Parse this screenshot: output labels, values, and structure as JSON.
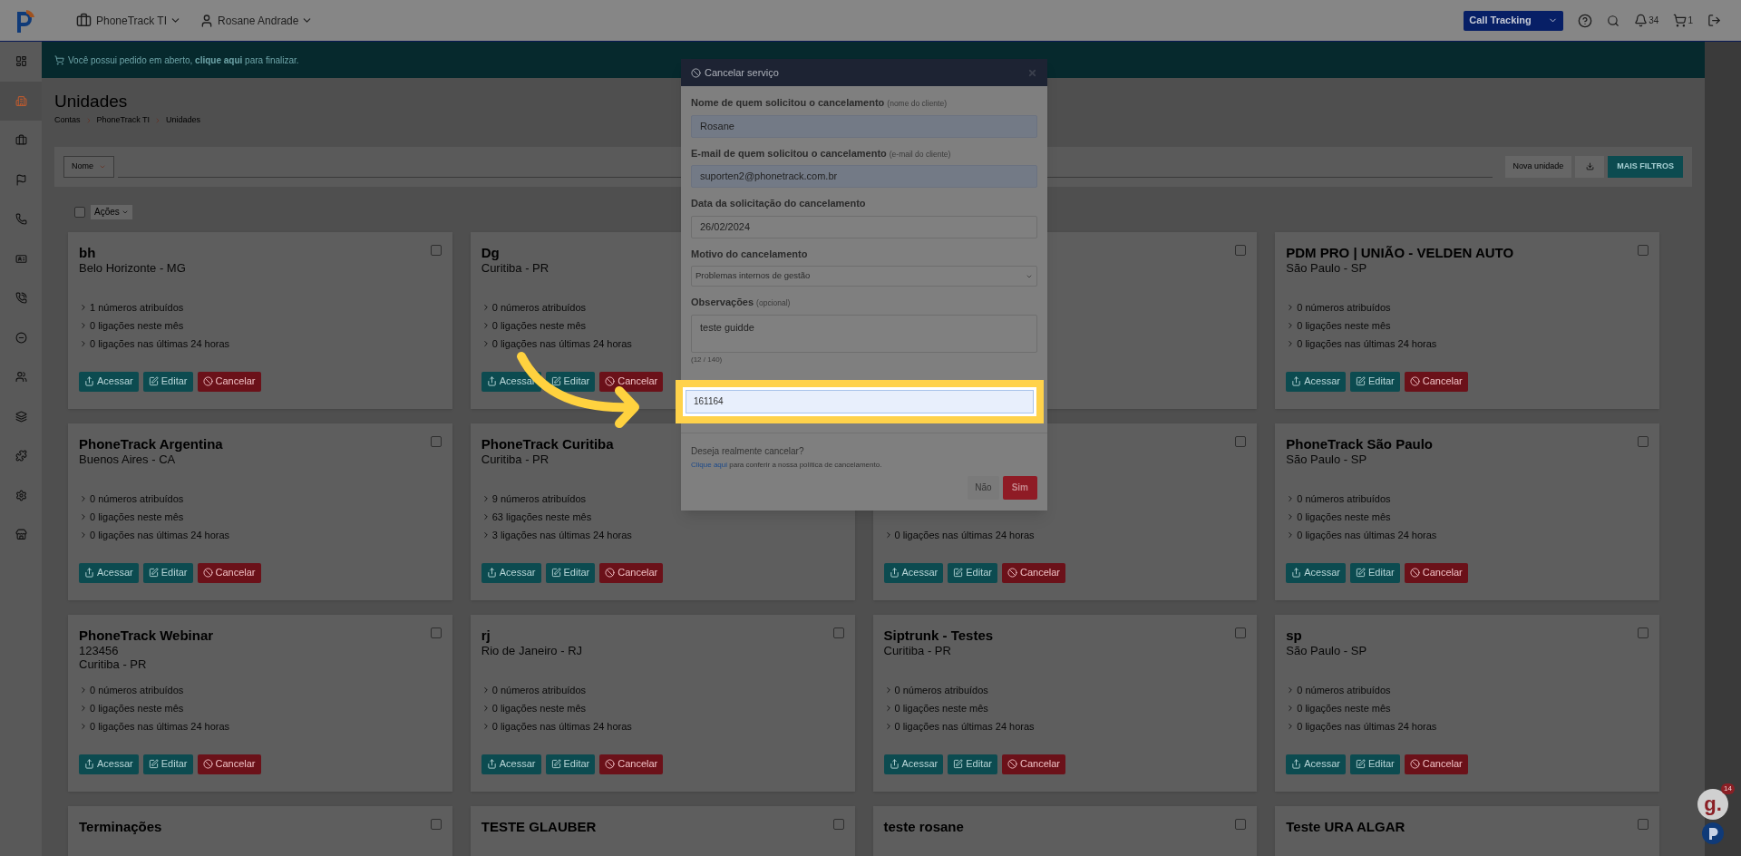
{
  "topbar": {
    "account": "PhoneTrack TI",
    "user": "Rosane Andrade",
    "product": "Call Tracking",
    "notifications": "34",
    "cart": "1"
  },
  "sidebar": {
    "items": [
      {
        "selected": false
      },
      {
        "selected": true
      },
      {
        "selected": false
      },
      {
        "selected": false
      },
      {
        "selected": false
      },
      {
        "selected": false
      },
      {
        "selected": false
      },
      {
        "selected": false
      },
      {
        "selected": false
      },
      {
        "selected": false
      },
      {
        "selected": false
      },
      {
        "selected": false
      },
      {
        "selected": false
      }
    ]
  },
  "banner": "Você possui pedido em aberto, **clique aqui** para finalizar.",
  "page": {
    "title": "Unidades",
    "breadcrumb": [
      "Contas",
      "PhoneTrack TI",
      "Unidades"
    ]
  },
  "filters": {
    "field": "Nome",
    "buttons": [
      "Nova unidade",
      "MAIS FILTROS"
    ]
  },
  "actions": {
    "label": "Ações",
    "checked": false
  },
  "cards": [
    {
      "title": "bh",
      "subtitles": [
        "Belo Horizonte - MG"
      ],
      "lines": [
        "1 números atribuídos",
        "0 ligações neste mês",
        "0 ligações nas últimas 24 horas"
      ],
      "checked": false,
      "buttons": [
        {
          "kind": "access",
          "label": "Acessar"
        },
        {
          "kind": "edit",
          "label": "Editar"
        },
        {
          "kind": "cancel",
          "label": "Cancelar"
        }
      ]
    },
    {
      "title": "Dg",
      "subtitles": [
        "Curitiba - PR"
      ],
      "lines": [
        "0 números atribuídos",
        "0 ligações neste mês",
        "0 ligações nas últimas 24 horas"
      ],
      "buttons": [
        {
          "kind": "access",
          "label": "Acessar"
        },
        {
          "kind": "edit",
          "label": "Editar"
        },
        {
          "kind": "cancel",
          "label": "Cancelar"
        }
      ]
    },
    {
      "checked": false
    },
    {
      "title": "PDM PRO | UNIÃO - VELDEN AUTO",
      "subtitles": [
        "São Paulo - SP"
      ],
      "lines": [
        "0 números atribuídos",
        "0 ligações neste mês",
        "0 ligações nas últimas 24 horas"
      ],
      "checked": false,
      "buttons": [
        {
          "kind": "access",
          "label": "Acessar"
        },
        {
          "kind": "edit",
          "label": "Editar"
        },
        {
          "kind": "cancel",
          "label": "Cancelar"
        }
      ]
    },
    {
      "title": "PhoneTrack Argentina",
      "subtitles": [
        "Buenos Aires - CA"
      ],
      "lines": [
        "0 números atribuídos",
        "0 ligações neste mês",
        "0 ligações nas últimas 24 horas"
      ],
      "checked": false,
      "buttons": [
        {
          "kind": "access",
          "label": "Acessar"
        },
        {
          "kind": "edit",
          "label": "Editar"
        },
        {
          "kind": "cancel",
          "label": "Cancelar"
        }
      ]
    },
    {
      "title": "PhoneTrack Curitiba",
      "subtitles": [
        "Curitiba - PR"
      ],
      "lines": [
        "9 números atribuídos",
        "63 ligações neste mês",
        "3 ligações nas últimas 24 horas"
      ],
      "buttons": [
        {
          "kind": "access",
          "label": "Acessar"
        },
        {
          "kind": "edit",
          "label": "Editar"
        },
        {
          "kind": "cancel",
          "label": "Cancelar"
        }
      ]
    },
    {
      "lines": [
        "0 ligações nas últimas 24 horas"
      ],
      "checked": false,
      "buttons": [
        {
          "kind": "access",
          "label": "Acessar"
        },
        {
          "kind": "edit",
          "label": "Editar"
        },
        {
          "kind": "cancel",
          "label": "Cancelar"
        }
      ]
    },
    {
      "title": "PhoneTrack São Paulo",
      "subtitles": [
        "São Paulo - SP"
      ],
      "lines": [
        "0 números atribuídos",
        "0 ligações neste mês",
        "0 ligações nas últimas 24 horas"
      ],
      "checked": false,
      "buttons": [
        {
          "kind": "access",
          "label": "Acessar"
        },
        {
          "kind": "edit",
          "label": "Editar"
        },
        {
          "kind": "cancel",
          "label": "Cancelar"
        }
      ]
    },
    {
      "title": "PhoneTrack Webinar",
      "subtitles": [
        "123456",
        "Curitiba - PR"
      ],
      "lines": [
        "0 números atribuídos",
        "0 ligações neste mês",
        "0 ligações nas últimas 24 horas"
      ],
      "checked": false,
      "buttons": [
        {
          "kind": "access",
          "label": "Acessar"
        },
        {
          "kind": "edit",
          "label": "Editar"
        },
        {
          "kind": "cancel",
          "label": "Cancelar"
        }
      ]
    },
    {
      "title": "rj",
      "subtitles": [
        "Rio de Janeiro - RJ"
      ],
      "lines": [
        "0 números atribuídos",
        "0 ligações neste mês",
        "0 ligações nas últimas 24 horas"
      ],
      "checked": false,
      "buttons": [
        {
          "kind": "access",
          "label": "Acessar"
        },
        {
          "kind": "edit",
          "label": "Editar"
        },
        {
          "kind": "cancel",
          "label": "Cancelar"
        }
      ]
    },
    {
      "title": "Siptrunk - Testes",
      "subtitles": [
        "Curitiba - PR"
      ],
      "lines": [
        "0 números atribuídos",
        "0 ligações neste mês",
        "0 ligações nas últimas 24 horas"
      ],
      "checked": false,
      "buttons": [
        {
          "kind": "access",
          "label": "Acessar"
        },
        {
          "kind": "edit",
          "label": "Editar"
        },
        {
          "kind": "cancel",
          "label": "Cancelar"
        }
      ]
    },
    {
      "title": "sp",
      "subtitles": [
        "São Paulo - SP"
      ],
      "lines": [
        "0 números atribuídos",
        "0 ligações neste mês",
        "0 ligações nas últimas 24 horas"
      ],
      "checked": false,
      "buttons": [
        {
          "kind": "access",
          "label": "Acessar"
        },
        {
          "kind": "edit",
          "label": "Editar"
        },
        {
          "kind": "cancel",
          "label": "Cancelar"
        }
      ]
    },
    {
      "title": "Terminações",
      "checked": false
    },
    {
      "title": "TESTE GLAUBER",
      "checked": false
    },
    {
      "title": "teste rosane",
      "checked": false
    },
    {
      "title": "Teste URA ALGAR",
      "checked": false
    }
  ],
  "modal": {
    "title": "Cancelar serviço",
    "fields": [
      {
        "kind": "input",
        "label": "Nome de quem solicitou o cancelamento",
        "hint": "(nome do cliente)",
        "value": "Rosane",
        "filled": true
      },
      {
        "kind": "input",
        "label": "E-mail de quem solicitou o cancelamento",
        "hint": "(e-mail do cliente)",
        "value": "suporten2@phonetrack.com.br",
        "filled": true
      },
      {
        "kind": "input",
        "label": "Data da solicitação do cancelamento",
        "value": "26/02/2024",
        "filled": false
      },
      {
        "kind": "select",
        "label": "Motivo do cancelamento",
        "value": "Problemas internos de gestão",
        "filled": false
      },
      {
        "kind": "textarea",
        "label": "Observações",
        "hint": "(opcional)",
        "value": "teste guidde",
        "counter": "(12 / 140)",
        "filled": false
      }
    ],
    "highlighted_value": "161164",
    "question": "Deseja realmente cancelar?",
    "link": "Clique aqui",
    "link_rest": " para conferir a nossa política de cancelamento.",
    "buttons": [
      "Não",
      "Sim"
    ]
  },
  "widget": {
    "logo": "g.",
    "badge": "14"
  }
}
